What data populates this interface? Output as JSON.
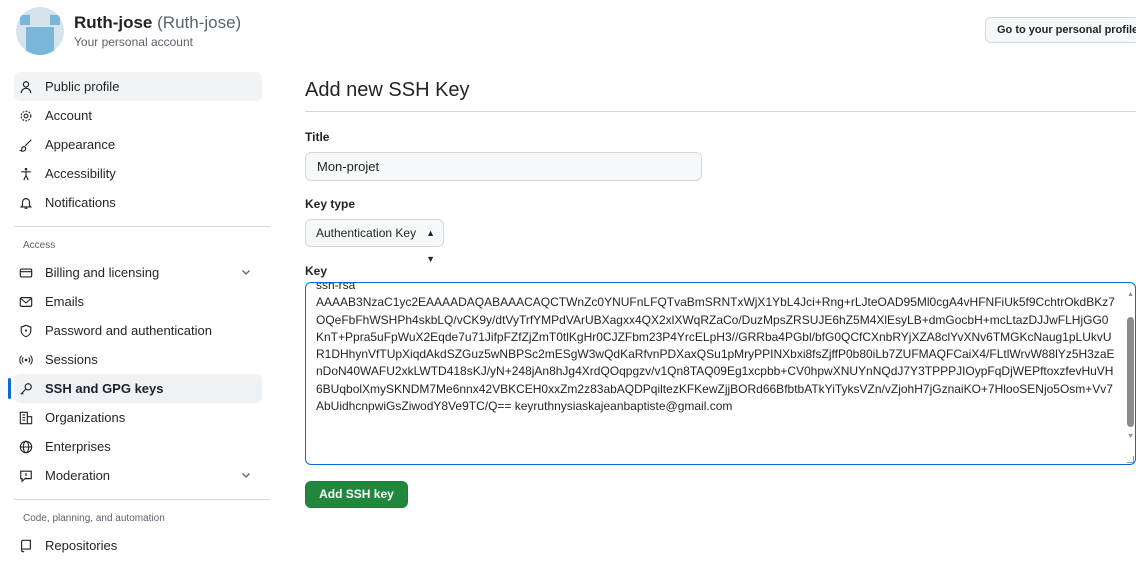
{
  "user": {
    "name": "Ruth-jose",
    "handle": "(Ruth-jose)",
    "subtitle": "Your personal account"
  },
  "header": {
    "profile_button": "Go to your personal profile"
  },
  "sidebar": {
    "items": [
      {
        "label": "Public profile",
        "icon": "person-icon"
      },
      {
        "label": "Account",
        "icon": "gear-icon"
      },
      {
        "label": "Appearance",
        "icon": "paintbrush-icon"
      },
      {
        "label": "Accessibility",
        "icon": "accessibility-icon"
      },
      {
        "label": "Notifications",
        "icon": "bell-icon"
      }
    ],
    "access_label": "Access",
    "access_items": [
      {
        "label": "Billing and licensing",
        "icon": "credit-card-icon"
      },
      {
        "label": "Emails",
        "icon": "mail-icon"
      },
      {
        "label": "Password and authentication",
        "icon": "shield-lock-icon"
      },
      {
        "label": "Sessions",
        "icon": "broadcast-icon"
      },
      {
        "label": "SSH and GPG keys",
        "icon": "key-icon"
      },
      {
        "label": "Organizations",
        "icon": "organization-icon"
      },
      {
        "label": "Enterprises",
        "icon": "globe-icon"
      },
      {
        "label": "Moderation",
        "icon": "report-icon"
      }
    ],
    "code_label": "Code, planning, and automation",
    "code_items": [
      {
        "label": "Repositories",
        "icon": "repo-icon"
      }
    ]
  },
  "main": {
    "page_title": "Add new SSH Key",
    "title_label": "Title",
    "title_value": "Mon-projet",
    "key_type_label": "Key type",
    "key_type_value": "Authentication Key",
    "key_label": "Key",
    "key_value": "ssh-rsa\nAAAAB3NzaC1yc2EAAAADAQABAAACAQCTWnZc0YNUFnLFQTvaBmSRNTxWjX1YbL4Jci+Rng+rLJteOAD95Ml0cgA4vHFNFiUk5f9CchtrOkdBKz7OQeFbFhWSHPh4skbLQ/vCK9y/dtVyTrfYMPdVArUBXagxx4QX2xlXWqRZaCo/DuzMpsZRSUJE6hZ5M4XlEsyLB+dmGocbH+mcLtazDJJwFLHjGG0KnT+Ppra5uFpWuX2Eqde7u71JifpFZfZjZmT0tlKgHr0CJZFbm23P4YrcELpH3//GRRba4PGbl/bfG0QCfCXnbRYjXZA8clYvXNv6TMGKcNaug1pLUkvUR1DHhynVfTUpXiqdAkdSZGuz5wNBPSc2mESgW3wQdKaRfvnPDXaxQSu1pMryPPINXbxi8fsZjffP0b80iLb7ZUFMAQFCaiX4/FLtlWrvW88lYz5H3zaEnDoN40WAFU2xkLWTD418sKJ/yN+248jAn8hJg4XrdQOqpgzv/v1Qn8TAQ09Eg1xcpbb+CV0hpwXNUYnNQdJ7Y3TPPPJIOypFqDjWEPftoxzfevHuVH6BUqbolXmySKNDM7Me6nnx42VBKCEH0xxZm2z83abAQDPqiltezKFKewZjjBORd66BfbtbATkYiTyksVZn/vZjohH7jGznaiKO+7HlooSENjo5Osm+Vv7AbUidhcnpwiGsZiwodY8Ve9TC/Q== keyruthnysiaskajeanbaptiste@gmail.com",
    "submit_label": "Add SSH key"
  },
  "colors": {
    "accent": "#0969da",
    "primary_button": "#1f883d"
  }
}
